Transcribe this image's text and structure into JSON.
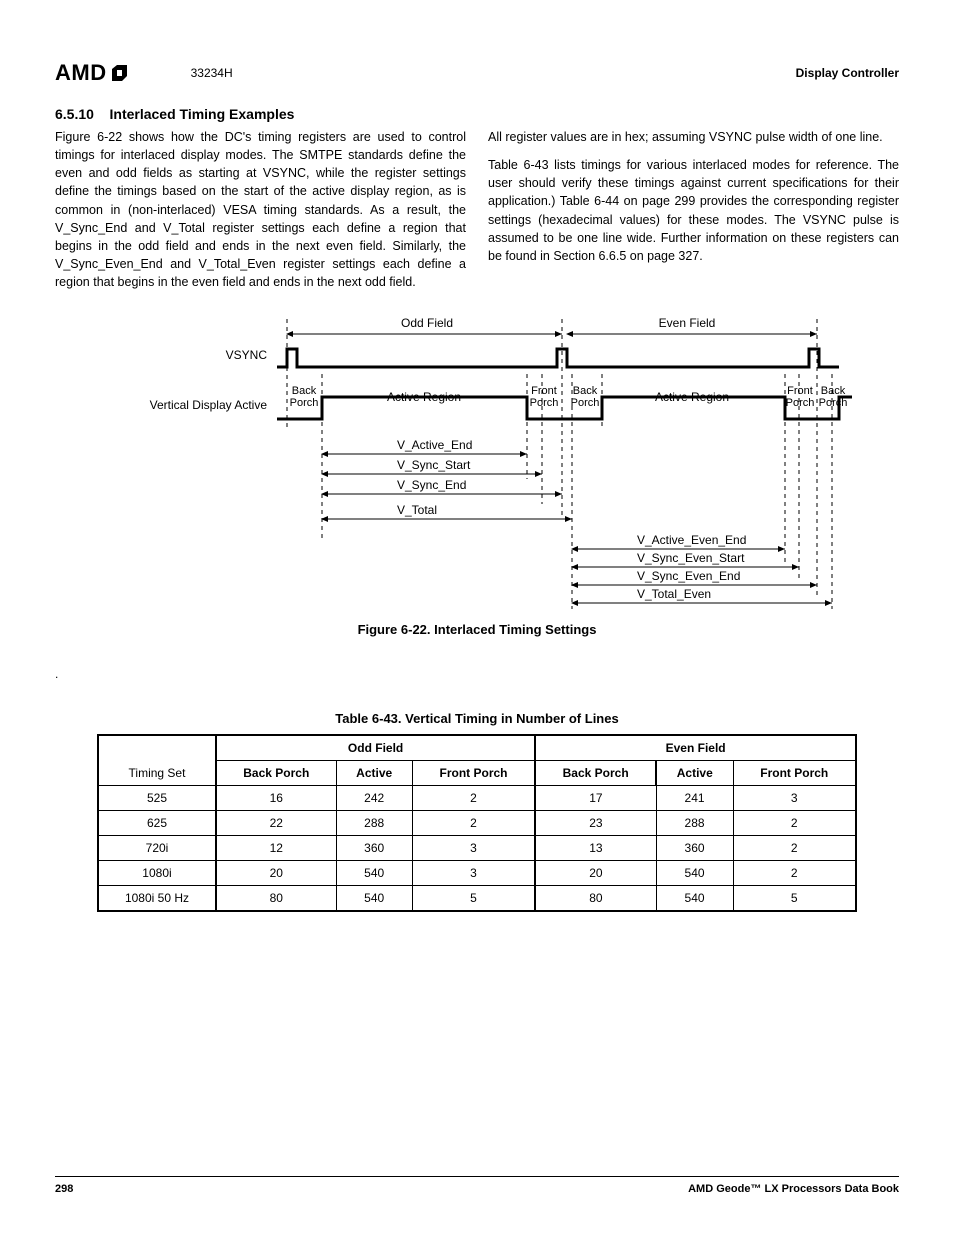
{
  "header": {
    "logo_text": "AMD",
    "doc_number": "33234H",
    "section_title": "Display Controller"
  },
  "section": {
    "number": "6.5.10",
    "title": "Interlaced Timing Examples"
  },
  "paragraphs": {
    "p1": "Figure 6-22 shows how the DC's timing registers are used to control timings for interlaced display modes. The SMTPE standards define the even and odd fields as starting at VSYNC, while the register settings define the timings based on the start of the active display region, as is common in (non-interlaced) VESA timing standards. As a result, the V_Sync_End and V_Total register settings each define a region that begins in the odd field and ends in the next even field. Similarly, the V_Sync_Even_End and V_Total_Even register settings each define a region that begins in the even field and ends in the next odd field.",
    "p2": "All register values are in hex; assuming VSYNC pulse width of one line.",
    "p3": "Table 6-43 lists timings for various interlaced modes for reference. The user should verify these timings against current specifications for their application.) Table 6-44 on page 299 provides the corresponding register settings (hexadecimal values) for these modes. The VSYNC pulse is assumed to be one line wide. Further information on these registers can be found in Section 6.6.5 on page 327."
  },
  "figure": {
    "caption": "Figure 6-22.  Interlaced Timing Settings",
    "labels": {
      "vsync": "VSYNC",
      "vda": "Vertical Display Active",
      "odd_field": "Odd Field",
      "even_field": "Even Field",
      "back_porch": "Back Porch",
      "front_porch": "Front Porch",
      "active_region": "Active Region",
      "v_active_end": "V_Active_End",
      "v_sync_start": "V_Sync_Start",
      "v_sync_end": "V_Sync_End",
      "v_total": "V_Total",
      "v_active_even_end": "V_Active_Even_End",
      "v_sync_even_start": "V_Sync_Even_Start",
      "v_sync_even_end": "V_Sync_Even_End",
      "v_total_even": "V_Total_Even"
    }
  },
  "table": {
    "caption": "Table 6-43.  Vertical Timing in Number of Lines",
    "col_group_odd": "Odd Field",
    "col_group_even": "Even Field",
    "col_timing_set": "Timing Set",
    "col_back_porch": "Back Porch",
    "col_active": "Active",
    "col_front_porch": "Front Porch",
    "rows": [
      {
        "set": "525",
        "obp": "16",
        "oa": "242",
        "ofp": "2",
        "ebp": "17",
        "ea": "241",
        "efp": "3"
      },
      {
        "set": "625",
        "obp": "22",
        "oa": "288",
        "ofp": "2",
        "ebp": "23",
        "ea": "288",
        "efp": "2"
      },
      {
        "set": "720i",
        "obp": "12",
        "oa": "360",
        "ofp": "3",
        "ebp": "13",
        "ea": "360",
        "efp": "2"
      },
      {
        "set": "1080i",
        "obp": "20",
        "oa": "540",
        "ofp": "3",
        "ebp": "20",
        "ea": "540",
        "efp": "2"
      },
      {
        "set": "1080i 50 Hz",
        "obp": "80",
        "oa": "540",
        "ofp": "5",
        "ebp": "80",
        "ea": "540",
        "efp": "5"
      }
    ]
  },
  "footer": {
    "page_number": "298",
    "book_title": "AMD Geode™ LX Processors Data Book"
  },
  "chart_data": {
    "type": "table",
    "title": "Vertical Timing in Number of Lines",
    "description": "Timing diagram for interlaced video showing odd and even fields, VSYNC pulses, back porch, active region, front porch, and register extents V_Active_End, V_Sync_Start, V_Sync_End, V_Total (odd-origin) and V_Active_Even_End, V_Sync_Even_Start, V_Sync_Even_End, V_Total_Even (even-origin).",
    "columns": [
      "Timing Set",
      "Odd Back Porch",
      "Odd Active",
      "Odd Front Porch",
      "Even Back Porch",
      "Even Active",
      "Even Front Porch"
    ],
    "rows": [
      [
        "525",
        16,
        242,
        2,
        17,
        241,
        3
      ],
      [
        "625",
        22,
        288,
        2,
        23,
        288,
        2
      ],
      [
        "720i",
        12,
        360,
        3,
        13,
        360,
        2
      ],
      [
        "1080i",
        20,
        540,
        3,
        20,
        540,
        2
      ],
      [
        "1080i 50 Hz",
        80,
        540,
        5,
        80,
        540,
        5
      ]
    ]
  }
}
